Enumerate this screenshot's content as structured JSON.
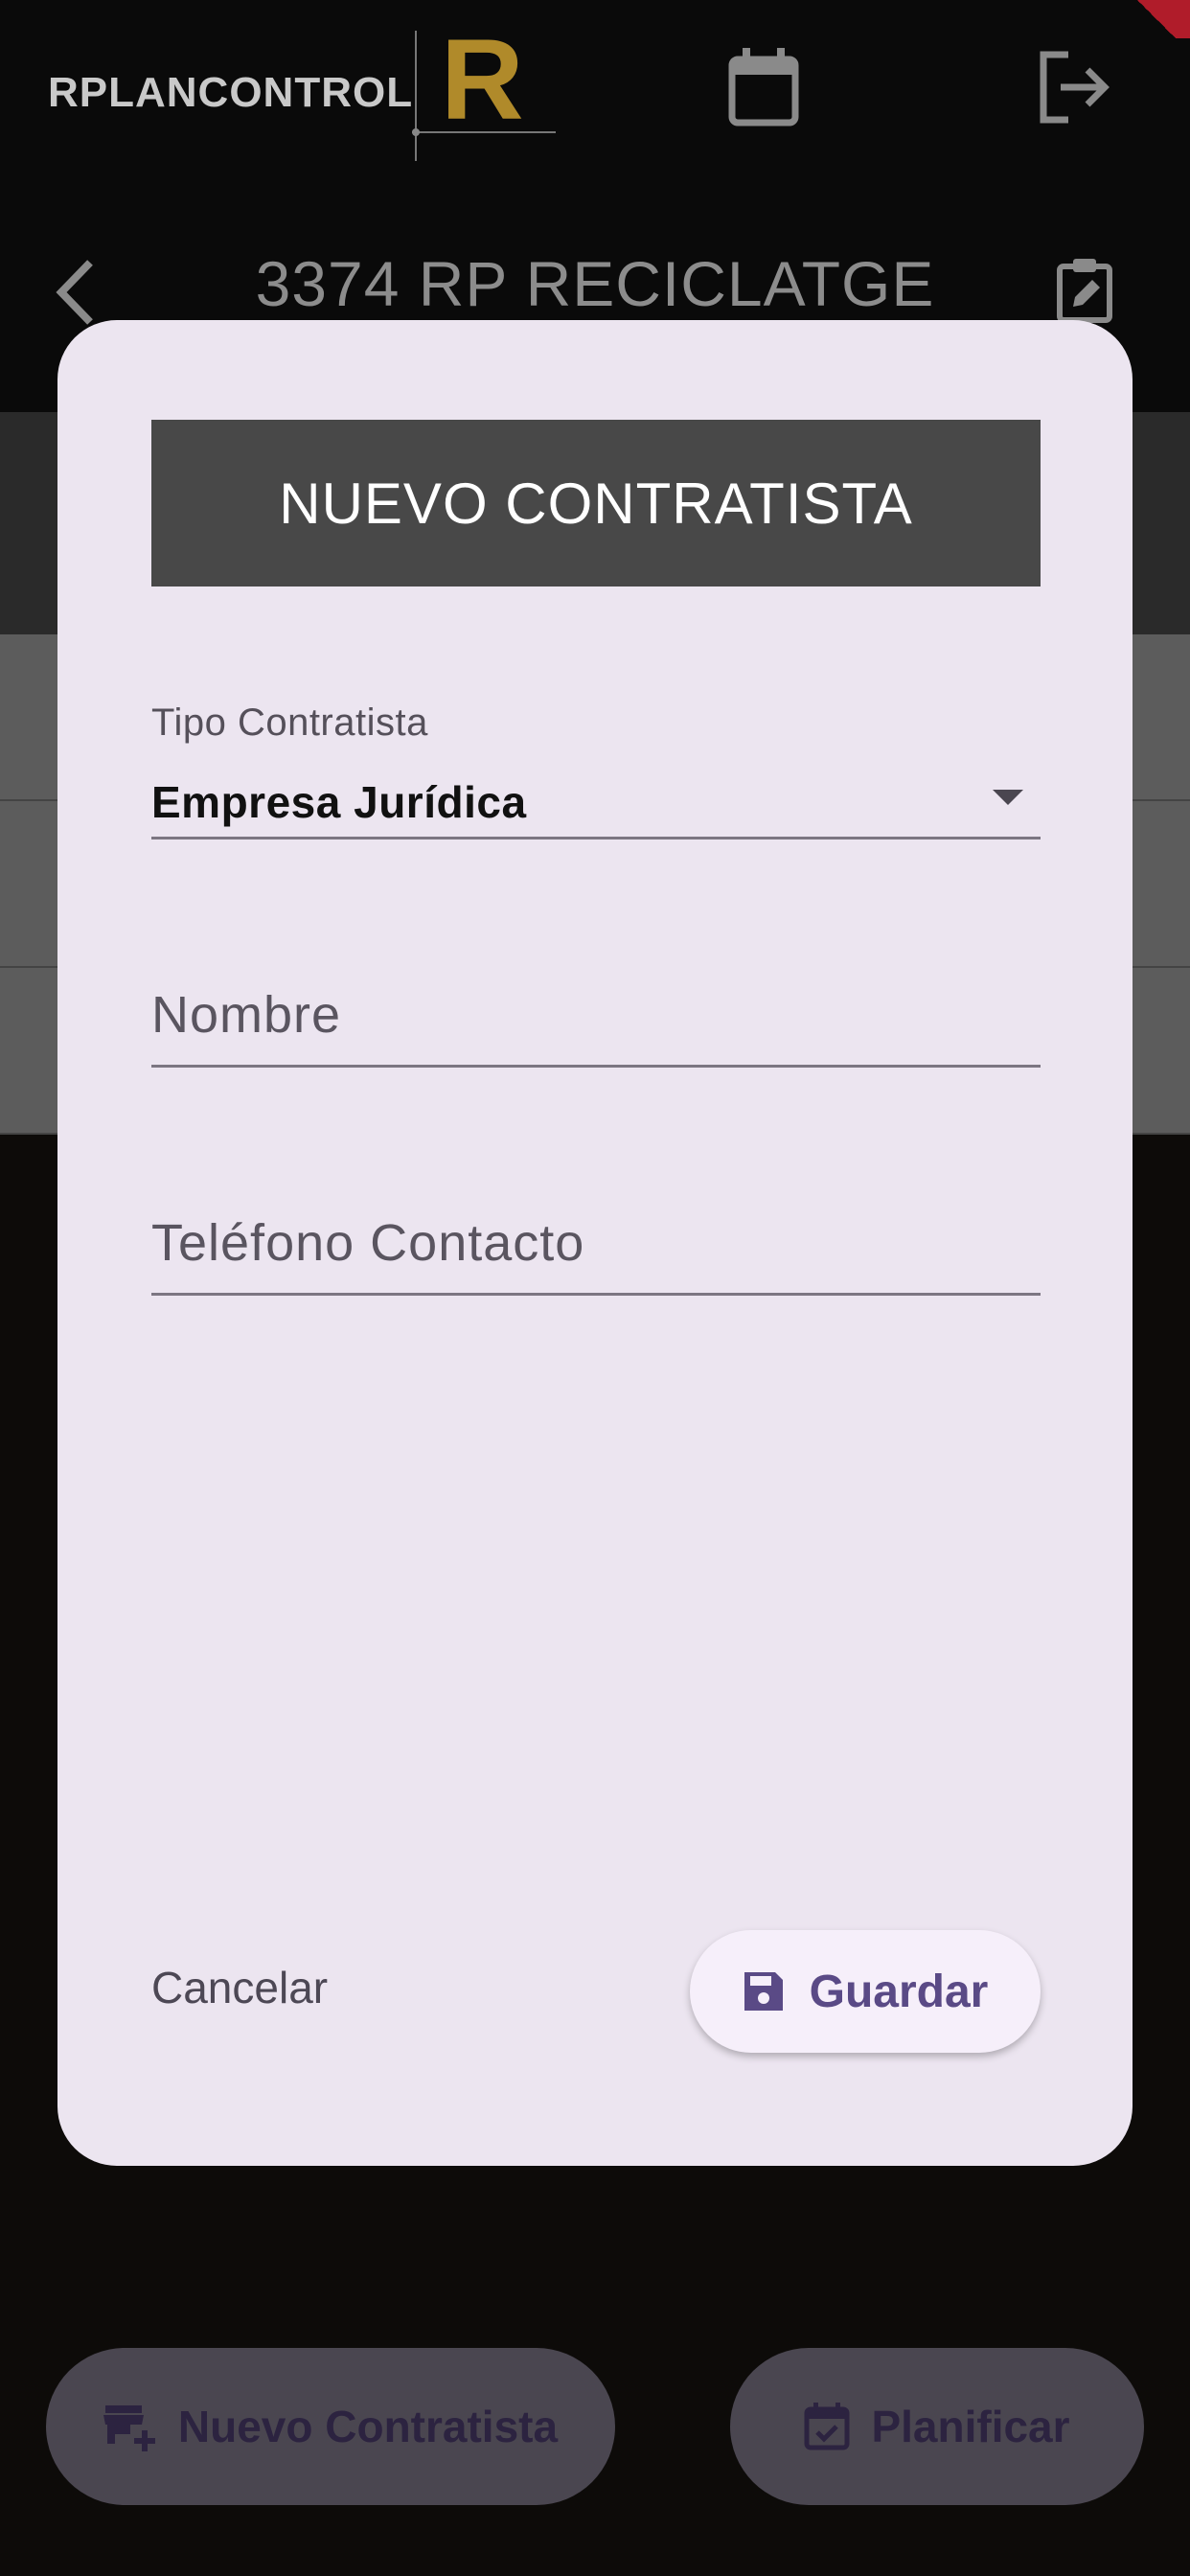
{
  "app": {
    "brand_text": "RPLANCONTROL",
    "brand_mark": "R",
    "icons": {
      "calendar": "calendar-icon",
      "logout": "logout-icon",
      "back": "chevron-left-icon",
      "edit": "edit-note-icon"
    }
  },
  "project": {
    "title": "3374 RP RECICLATGE"
  },
  "dialog": {
    "title": "NUEVO CONTRATISTA",
    "tipo": {
      "label": "Tipo Contratista",
      "value": "Empresa Jurídica"
    },
    "nombre": {
      "placeholder": "Nombre",
      "value": ""
    },
    "telefono": {
      "placeholder": "Teléfono Contacto",
      "value": ""
    },
    "cancel_label": "Cancelar",
    "save_label": "Guardar"
  },
  "fabs": {
    "nuevo_label": "Nuevo Contratista",
    "planificar_label": "Planificar"
  },
  "colors": {
    "accent": "#5a4a86",
    "dialog_bg": "#ece5f0",
    "header_bg": "#484848",
    "logo_gold": "#b08a2a"
  }
}
